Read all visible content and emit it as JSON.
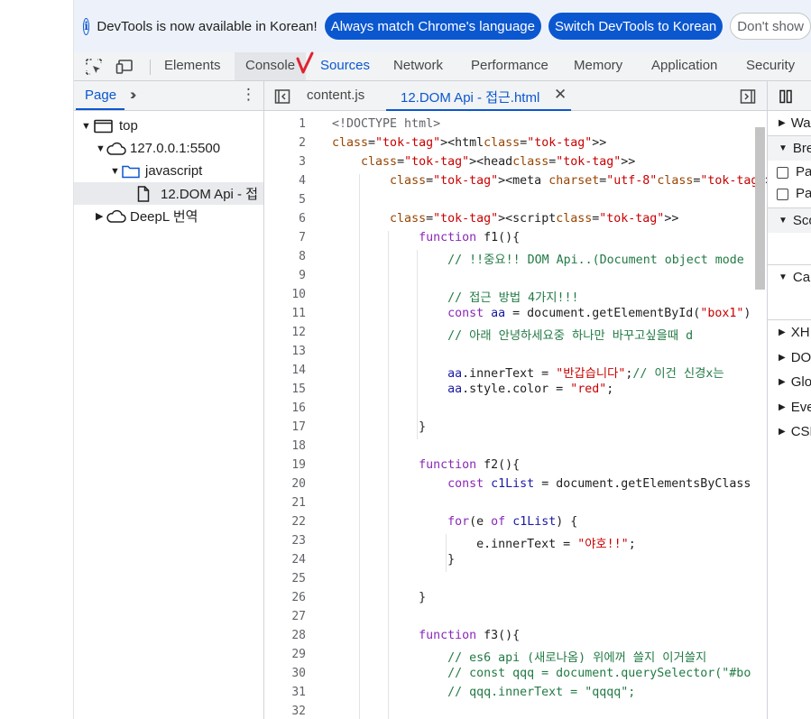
{
  "infobar": {
    "message": "DevTools is now available in Korean!",
    "match_button": "Always match Chrome's language",
    "switch_button": "Switch DevTools to Korean",
    "dont_show_button": "Don't show"
  },
  "main_tabs": [
    "Elements",
    "Console",
    "Sources",
    "Network",
    "Performance",
    "Memory",
    "Application",
    "Security"
  ],
  "active_main_tab": "Sources",
  "navigator": {
    "tab_label": "Page",
    "tree": [
      {
        "label": "top",
        "type": "frame",
        "expanded": true,
        "depth": 0
      },
      {
        "label": "127.0.0.1:5500",
        "type": "cloud",
        "expanded": true,
        "depth": 1
      },
      {
        "label": "javascript",
        "type": "folder",
        "expanded": true,
        "depth": 2
      },
      {
        "label": "12.DOM Api - 접",
        "type": "file",
        "depth": 3,
        "selected": true
      },
      {
        "label": "DeepL 번역",
        "type": "cloud",
        "expanded": false,
        "depth": 1
      }
    ]
  },
  "editor": {
    "tabs": [
      {
        "label": "content.js",
        "active": false
      },
      {
        "label": "12.DOM Api - 접근.html",
        "active": true,
        "closable": true
      }
    ],
    "lines": [
      "<!DOCTYPE html>",
      "<html>",
      "    <head>",
      "        <meta charset=\"utf-8\">",
      "",
      "        <script>",
      "            function f1(){",
      "                // !!중요!! DOM Api..(Document object mode",
      "",
      "                // 접근 방법 4가지!!!",
      "                const aa = document.getElementById(\"box1\")",
      "                // 아래 안녕하세요중 하나만 바꾸고싶을때 d",
      "",
      "                aa.innerText = \"반갑습니다\";// 이건 신경x는",
      "                aa.style.color = \"red\";",
      "",
      "            }",
      "",
      "            function f2(){",
      "                const c1List = document.getElementsByClass",
      "",
      "                for(e of c1List) {",
      "                    e.innerText = \"야호!!\";",
      "                }",
      "",
      "            }",
      "",
      "            function f3(){",
      "                // es6 api (새로나옴) 위에꺼 쓸지 이거쓸지",
      "                // const qqq = document.querySelector(\"#bo",
      "                // qqq.innerText = \"qqqq\";",
      ""
    ]
  },
  "sidebar": {
    "sections": [
      "Wa",
      "Bre",
      "Sco",
      "Cal",
      "XH",
      "DO",
      "Glo",
      "Eve",
      "CSF"
    ],
    "breakpoint_options": [
      "Pau",
      "Pau"
    ]
  },
  "colors": {
    "accent": "#0b57d0",
    "red_annotation": "#e0232e",
    "comment": "#227a45",
    "string": "#c80000",
    "keyword": "#8928b8"
  }
}
